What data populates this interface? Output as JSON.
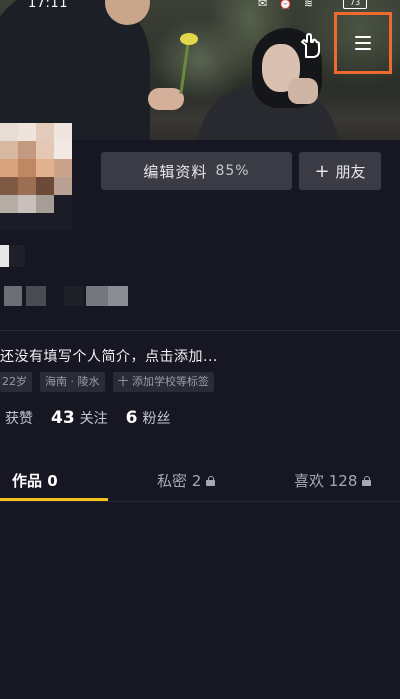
{
  "status_bar": {
    "time": "17:11",
    "icons": "✉ ⏰ ≋",
    "battery": "73"
  },
  "cover": {
    "hand_icon": "pointing-hand-icon",
    "menu_icon": "hamburger-menu-icon",
    "menu_highlight_color": "#f06a30"
  },
  "profile": {
    "edit_button_label": "编辑资料",
    "edit_progress": "85%",
    "add_friend_label": "朋友",
    "add_friend_icon": "plus-icon",
    "bio": "还没有填写个人简介，点击添加...",
    "tags": [
      "22岁",
      "海南 · 陵水",
      "十 添加学校等标签"
    ],
    "stats": [
      {
        "value": "",
        "label": "获赞"
      },
      {
        "value": "43",
        "label": "关注"
      },
      {
        "value": "6",
        "label": "粉丝"
      }
    ]
  },
  "tabs": [
    {
      "label": "作品 0",
      "active": true,
      "locked": false
    },
    {
      "label": "私密 2",
      "active": false,
      "locked": true
    },
    {
      "label": "喜欢 128",
      "active": false,
      "locked": true
    }
  ],
  "colors": {
    "background": "#161722",
    "button_bg": "#3a3b45",
    "tab_indicator": "#f2c21a"
  }
}
